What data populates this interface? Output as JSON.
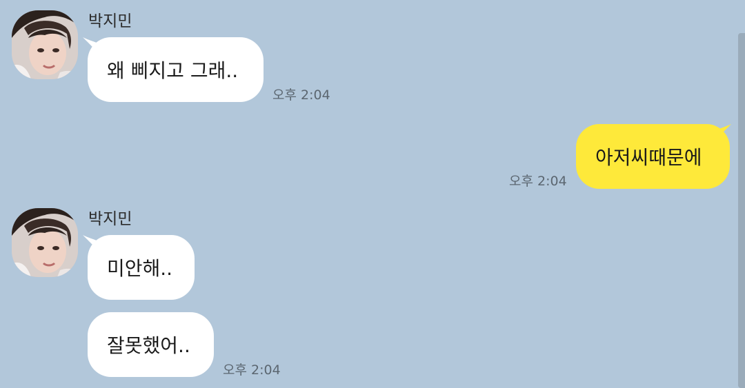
{
  "chat": {
    "sender_name": "박지민",
    "messages": [
      {
        "text": "왜 삐지고 그래..",
        "time": "오후 2:04"
      },
      {
        "text": "아저씨때문에",
        "time": "오후 2:04"
      },
      {
        "text": "미안해.."
      },
      {
        "text": "잘못했어..",
        "time": "오후 2:04"
      }
    ]
  },
  "colors": {
    "background": "#b2c7da",
    "incoming_bubble": "#ffffff",
    "outgoing_bubble": "#fee93a",
    "timestamp": "#5b6670"
  },
  "icons": {
    "avatar": "profile-photo"
  }
}
